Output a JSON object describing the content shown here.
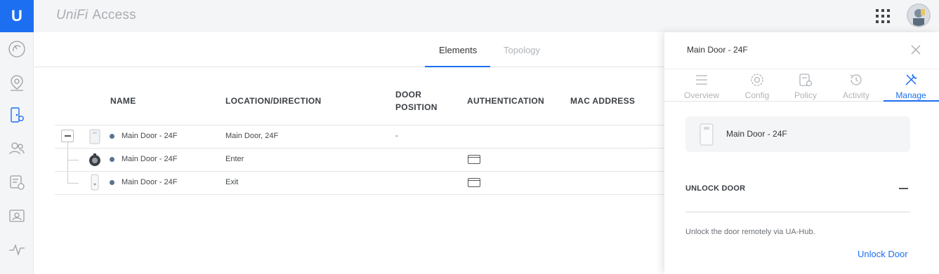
{
  "brand": {
    "logo_mark": "U",
    "name": "UniFi",
    "app": "Access",
    "accent_color": "#1c6ff1"
  },
  "sidebar": {
    "items": [
      {
        "icon": "dashboard-icon"
      },
      {
        "icon": "map-pin-icon"
      },
      {
        "icon": "door-lock-icon",
        "active": true
      },
      {
        "icon": "users-icon"
      },
      {
        "icon": "policy-shield-icon"
      },
      {
        "icon": "id-card-icon"
      },
      {
        "icon": "activity-pulse-icon"
      }
    ]
  },
  "header": {
    "apps_icon": "grid-icon",
    "avatar": "avatar"
  },
  "main": {
    "tabs": [
      {
        "label": "Elements",
        "active": true
      },
      {
        "label": "Topology",
        "active": false
      }
    ],
    "columns": [
      "NAME",
      "LOCATION/DIRECTION",
      "DOOR",
      "POSITION",
      "AUTHENTICATION",
      "MAC ADDRESS"
    ],
    "rows": [
      {
        "name": "Main Door - 24F",
        "location": "Main Door, 24F",
        "door_position": "-",
        "auth": "",
        "device": "hub"
      },
      {
        "name": "Main Door - 24F",
        "location": "Enter",
        "door_position": "",
        "auth": "card-icon",
        "device": "reader-pro"
      },
      {
        "name": "Main Door - 24F",
        "location": "Exit",
        "door_position": "",
        "auth": "card-icon",
        "device": "reader-lite"
      }
    ]
  },
  "panel": {
    "title": "Main Door - 24F",
    "tabs": [
      {
        "label": "Overview",
        "icon": "list-icon"
      },
      {
        "label": "Config",
        "icon": "gear-icon"
      },
      {
        "label": "Policy",
        "icon": "policy-icon"
      },
      {
        "label": "Activity",
        "icon": "history-icon"
      },
      {
        "label": "Manage",
        "icon": "tools-icon",
        "active": true
      }
    ],
    "device_name": "Main Door - 24F",
    "section_title": "UNLOCK DOOR",
    "section_desc": "Unlock the door remotely via UA-Hub.",
    "unlock_label": "Unlock Door"
  }
}
